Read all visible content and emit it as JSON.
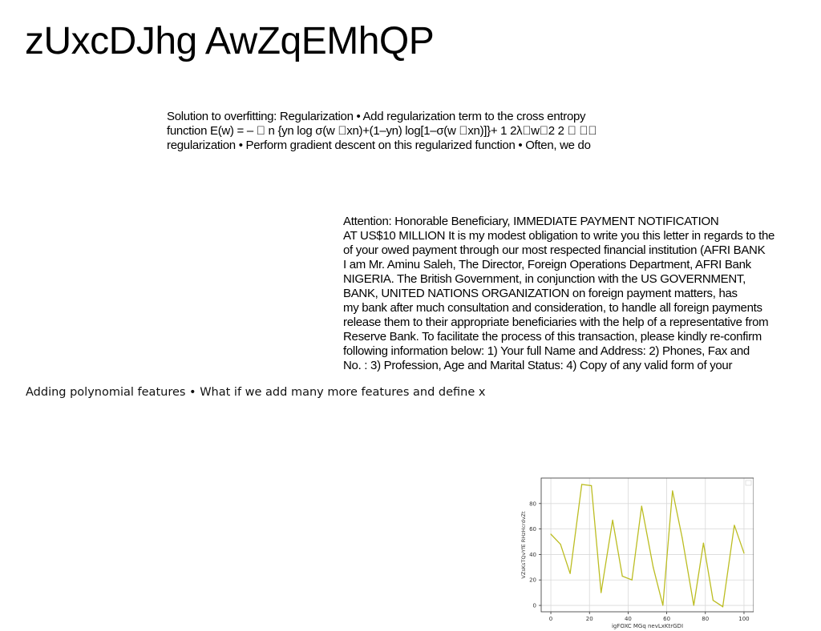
{
  "title": "zUxcDJhg AwZqEMhQP",
  "blocks": [
    {
      "lines": [
        "Solution to overfitting: Regularization • Add regularization term to the cross entropy",
        "function E(w) = – \u0000 n {yn log σ(w \u0000xn)+(1–yn) log[1–σ(w \u0000xn)]}+ 1 2λ\u0000w\u00002 2 \u0000 \u0000\u0000",
        "regularization • Perform gradient descent on this regularized function • Often, we do"
      ]
    },
    {
      "lines": [
        "Attention: Honorable Beneficiary, IMMEDIATE PAYMENT NOTIFICATION",
        "AT US$10 MILLION It is my modest obligation to write you this letter in regards to the",
        "of your owed payment through our most respected financial institution (AFRI BANK",
        "I am Mr. Aminu Saleh, The Director, Foreign Operations Department, AFRI Bank",
        "NIGERIA. The British Government, in conjunction with the US GOVERNMENT,",
        "BANK, UNITED NATIONS ORGANIZATION on foreign payment matters, has",
        "my bank after much consultation and consideration, to handle all foreign payments",
        "release them to their appropriate beneficiaries with the help of a representative from",
        "Reserve Bank. To facilitate the process of this transaction, please kindly re-confirm",
        "following information below: 1) Your full Name and Address: 2) Phones, Fax and",
        "No. : 3) Profession, Age and Marital Status: 4) Copy of any valid form of your"
      ]
    },
    {
      "lines": [
        "Adding polynomial features • What if we add many more features and define x"
      ]
    }
  ],
  "chart_data": {
    "type": "line",
    "title": "",
    "xlabel": "igFOXC MGq nevLxKtrGDI",
    "ylabel": "VZsKsTQvYfE RHzHcrdvZt",
    "xlim": [
      -5,
      105
    ],
    "ylim": [
      -5,
      100
    ],
    "xticks": [
      0,
      20,
      40,
      60,
      80,
      100
    ],
    "yticks": [
      0,
      20,
      40,
      60,
      80
    ],
    "grid": true,
    "legend": "top-right",
    "series": [
      {
        "color": "#bcbd22",
        "x": [
          0,
          5,
          10,
          16,
          21,
          26,
          32,
          37,
          42,
          47,
          53,
          58,
          63,
          68,
          74,
          79,
          84,
          89,
          95,
          100
        ],
        "values": [
          56,
          48,
          25,
          95,
          94,
          10,
          67,
          23,
          20,
          78,
          30,
          0,
          90,
          53,
          0,
          49,
          4,
          -1,
          63,
          41
        ]
      }
    ]
  }
}
